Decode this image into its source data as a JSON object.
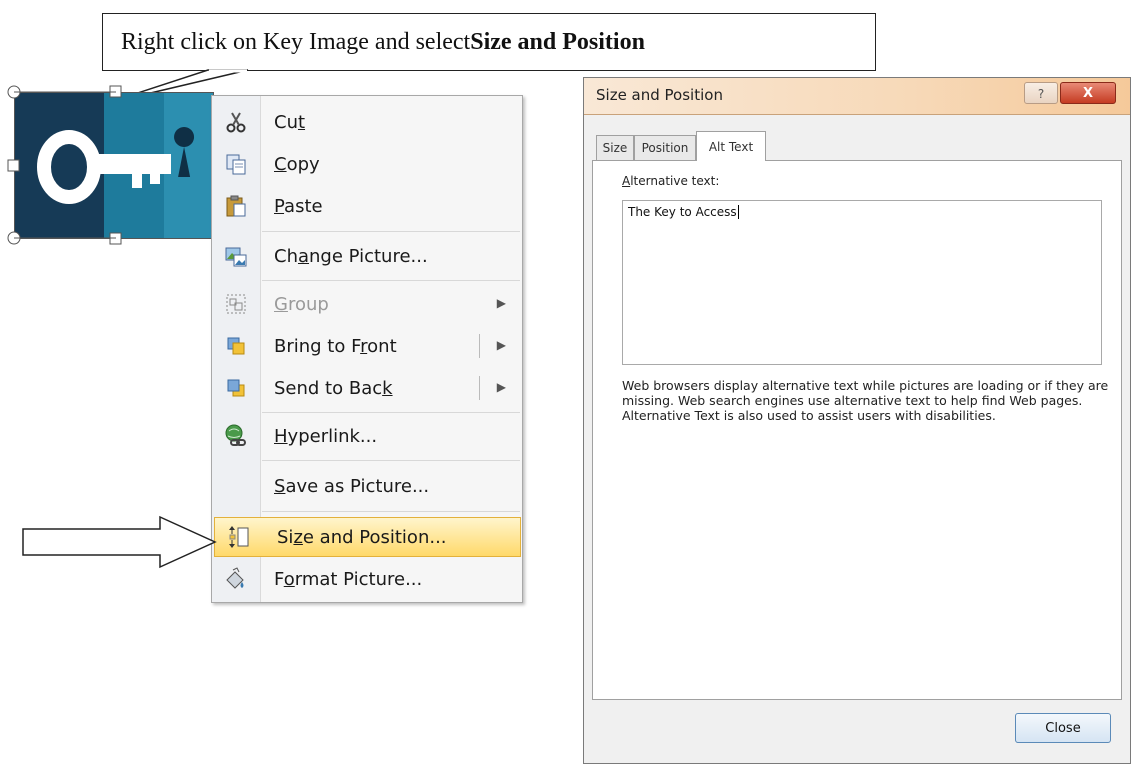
{
  "callout": {
    "prefix": "Right click on Key Image and select ",
    "bold": "Size and Position"
  },
  "menu": {
    "items": [
      {
        "icon": "scissors-icon",
        "pre": "Cu",
        "u": "t",
        "post": ""
      },
      {
        "icon": "copy-icon",
        "pre": "",
        "u": "C",
        "post": "opy"
      },
      {
        "icon": "clipboard-icon",
        "pre": "",
        "u": "P",
        "post": "aste"
      },
      {
        "icon": "change-picture-icon",
        "pre": "Ch",
        "u": "a",
        "post": "nge Picture..."
      },
      {
        "icon": "group-icon",
        "pre": "",
        "u": "G",
        "post": "roup",
        "disabled": true
      },
      {
        "icon": "bring-front-icon",
        "pre": "Bring to F",
        "u": "r",
        "post": "ont"
      },
      {
        "icon": "send-back-icon",
        "pre": "Send to Bac",
        "u": "k",
        "post": ""
      },
      {
        "icon": "hyperlink-icon",
        "pre": "",
        "u": "H",
        "post": "yperlink..."
      },
      {
        "icon": "",
        "pre": "",
        "u": "S",
        "post": "ave as Picture..."
      },
      {
        "icon": "size-position-icon",
        "pre": "Si",
        "u": "z",
        "post": "e and Position...",
        "highlight": true
      },
      {
        "icon": "format-picture-icon",
        "pre": "F",
        "u": "o",
        "post": "rmat Picture..."
      }
    ]
  },
  "dialog": {
    "title": "Size and Position",
    "help_glyph": "?",
    "close_glyph": "X",
    "tabs": [
      "Size",
      "Position",
      "Alt Text"
    ],
    "alt_label_u": "A",
    "alt_label_rest": "lternative text:",
    "alt_value": "The Key to Access",
    "help_text": "Web browsers display alternative text while pictures are loading or if they are missing.  Web search engines use alternative text to help find Web pages.  Alternative Text is also used to assist users with disabilities.",
    "close_label": "Close"
  },
  "colors": {
    "highlight": "#ffd96a",
    "key_dark": "#163a56",
    "key_light": "#1e7b9c",
    "titlebar": "#f7d9b8"
  }
}
